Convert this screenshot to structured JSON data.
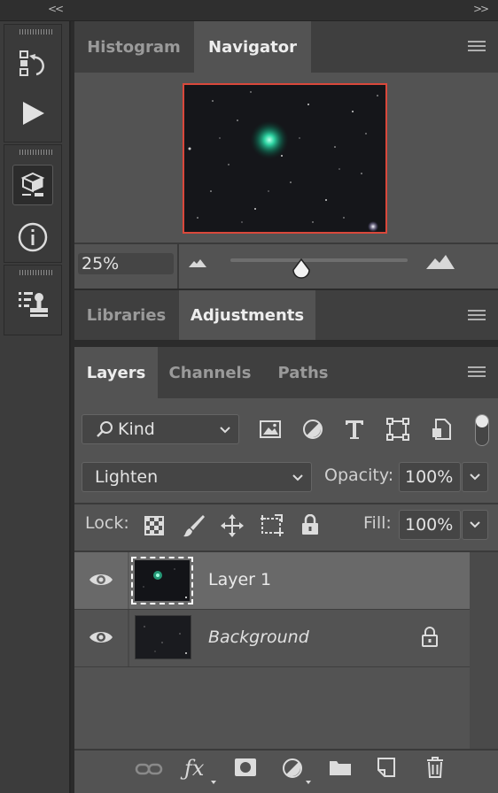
{
  "top_strip": {
    "collapse_left": "<<",
    "collapse_right": ">>"
  },
  "navigator_panel": {
    "tabs": [
      "Histogram",
      "Navigator"
    ],
    "active_tab": "Navigator",
    "zoom_value": "25%",
    "slider_level": 0.4
  },
  "adjustments_panel": {
    "tabs": [
      "Libraries",
      "Adjustments"
    ],
    "active_tab": "Adjustments"
  },
  "layers_panel": {
    "tabs": [
      "Layers",
      "Channels",
      "Paths"
    ],
    "active_tab": "Layers",
    "filter_kind": "Kind",
    "blend_mode": "Lighten",
    "opacity_label": "Opacity:",
    "opacity_value": "100%",
    "lock_label": "Lock:",
    "fill_label": "Fill:",
    "fill_value": "100%",
    "layers": [
      {
        "name": "Layer 1",
        "selected": true,
        "visible": true
      },
      {
        "name": "Background",
        "selected": false,
        "visible": true,
        "locked": true
      }
    ]
  },
  "colors": {
    "panel": "#535353",
    "tab_bar": "#3f3f3f",
    "selected_row": "#696969",
    "nav_frame": "#d9483b",
    "comet": "#27c79a"
  }
}
